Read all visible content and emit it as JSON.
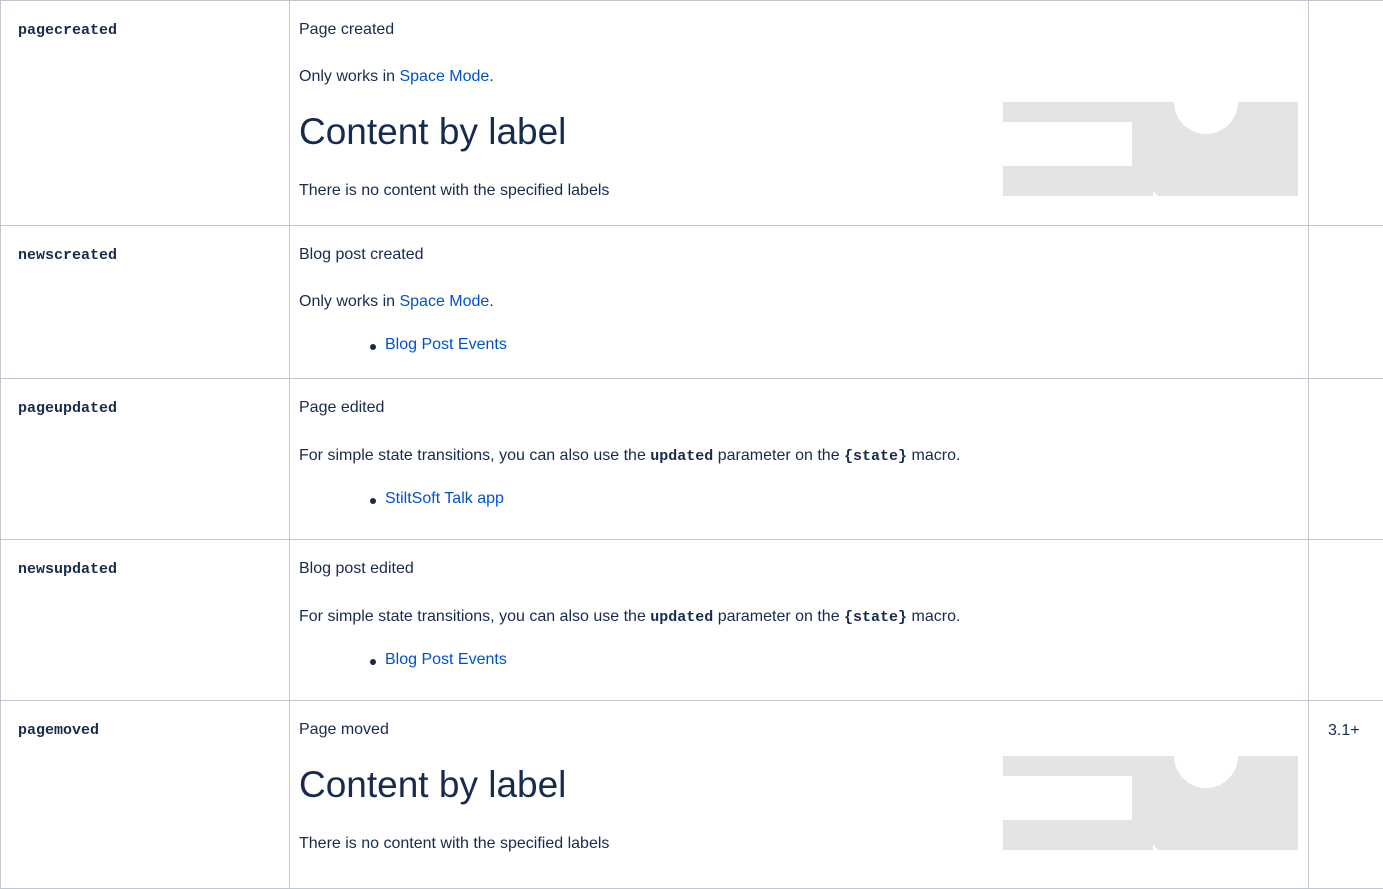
{
  "rows": [
    {
      "key": "pagecreated",
      "title": "Page created",
      "note_prefix": "Only works in ",
      "note_link": "Space Mode",
      "note_suffix": ".",
      "content_title": "Content by label",
      "content_empty": "There is no content with the specified labels",
      "version": ""
    },
    {
      "key": "newscreated",
      "title": "Blog post created",
      "note_prefix": "Only works in ",
      "note_link": "Space Mode",
      "note_suffix": ".",
      "bullet": "Blog Post Events",
      "version": ""
    },
    {
      "key": "pageupdated",
      "title": "Page edited",
      "text_a": "For simple state transitions, you can also use the ",
      "code_a": "updated",
      "text_b": " parameter on the ",
      "code_b": "{state}",
      "text_c": " macro.",
      "bullet": "StiltSoft Talk app",
      "version": ""
    },
    {
      "key": "newsupdated",
      "title": "Blog post edited",
      "text_a": "For simple state transitions, you can also use the ",
      "code_a": "updated",
      "text_b": " parameter on the ",
      "code_b": "{state}",
      "text_c": " macro.",
      "bullet": "Blog Post Events",
      "version": ""
    },
    {
      "key": "pagemoved",
      "title": "Page moved",
      "content_title": "Content by label",
      "content_empty": "There is no content with the specified labels",
      "version": "3.1+"
    }
  ],
  "colors": {
    "link": "#0052cc",
    "text": "#172b4d",
    "border": "#c1c7d0",
    "placeholder": "#e4e4e4"
  }
}
